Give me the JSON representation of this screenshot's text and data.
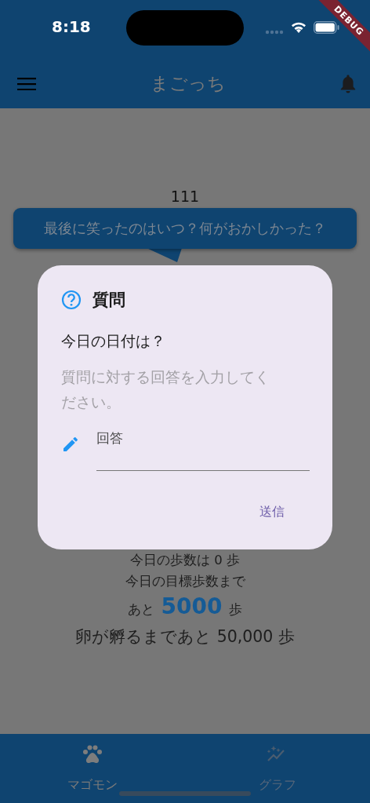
{
  "status_bar": {
    "time": "8:18"
  },
  "debug_banner": {
    "label": "DEBUG"
  },
  "app_bar": {
    "title": "まごっち"
  },
  "counter": "111",
  "tooltip": {
    "text": "最後に笑ったのはいつ？何がおかしかった？"
  },
  "dialog": {
    "title": "質問",
    "question": "今日の日付は？",
    "hint": "質問に対する回答を入力してください。",
    "field": {
      "placeholder": "回答"
    },
    "actions": [
      "送信"
    ]
  },
  "steps": {
    "today": "今日の歩数は 0 歩",
    "goal_label": "今日の目標歩数まで",
    "remaining_prefix": "あと",
    "remaining": "5000",
    "remaining_unit": "歩",
    "hatch": "卵が孵るまであと 50,000 歩"
  },
  "bottom_nav": [
    {
      "label": "マゴモン",
      "selected": true
    },
    {
      "label": "グラフ",
      "selected": false
    }
  ]
}
